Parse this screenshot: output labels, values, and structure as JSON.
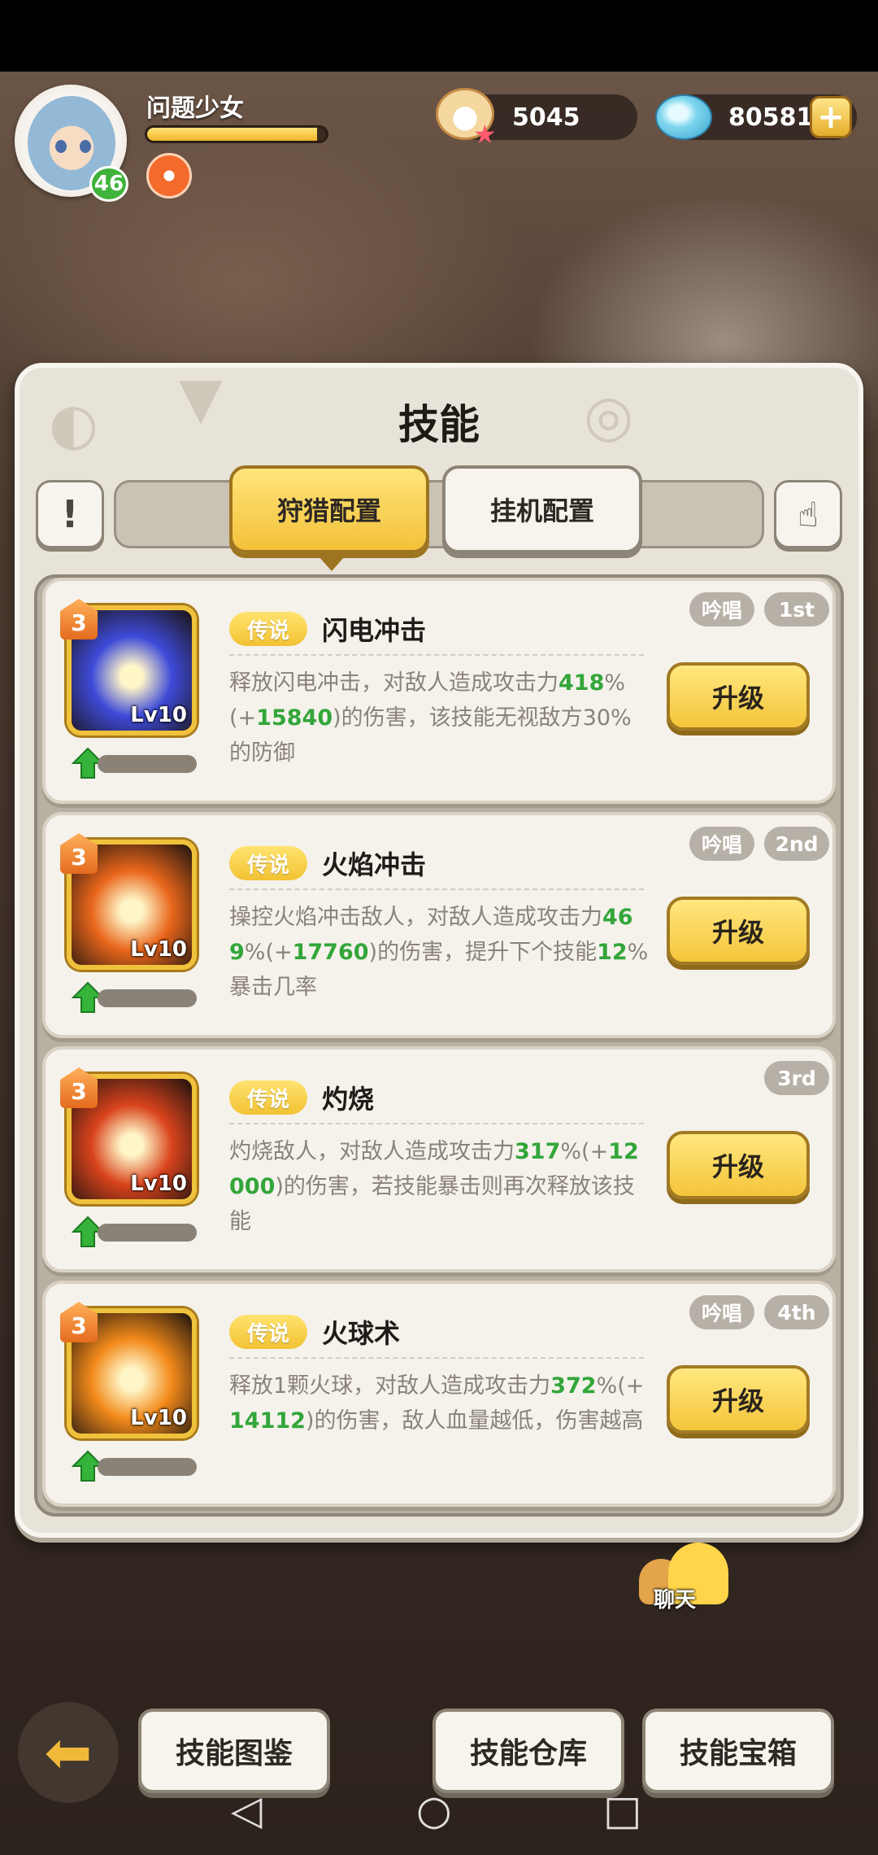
{
  "player": {
    "name": "问题少女",
    "level": "46",
    "xp_fraction": 0.95
  },
  "currency": {
    "pearls": "5045",
    "gems": "80581"
  },
  "panel": {
    "title": "技能"
  },
  "tabs": [
    {
      "label": "狩猎配置",
      "active": true
    },
    {
      "label": "挂机配置",
      "active": false
    }
  ],
  "skills": [
    {
      "star": "3",
      "level": "Lv10",
      "rarity": "传说",
      "name": "闪电冲击",
      "chant": "吟唱",
      "order": "1st",
      "desc_parts": [
        "释放闪电冲击，对敌人造成攻击力",
        "418",
        "%(+",
        "15840",
        ")的伤害，该技能无视敌方30%的防御"
      ],
      "upgrade": "升级",
      "icon_color": "#3d4ad8"
    },
    {
      "star": "3",
      "level": "Lv10",
      "rarity": "传说",
      "name": "火焰冲击",
      "chant": "吟唱",
      "order": "2nd",
      "desc_parts": [
        "操控火焰冲击敌人，对敌人造成攻击力",
        "469",
        "%(+",
        "17760",
        ")的伤害，提升下个技能",
        "12",
        "%暴击几率"
      ],
      "upgrade": "升级",
      "icon_color": "#e9661b"
    },
    {
      "star": "3",
      "level": "Lv10",
      "rarity": "传说",
      "name": "灼烧",
      "chant": "",
      "order": "3rd",
      "desc_parts": [
        "灼烧敌人，对敌人造成攻击力",
        "317",
        "%(+",
        "12000",
        ")的伤害，若技能暴击则再次释放该技能"
      ],
      "upgrade": "升级",
      "icon_color": "#d9431c"
    },
    {
      "star": "3",
      "level": "Lv10",
      "rarity": "传说",
      "name": "火球术",
      "chant": "吟唱",
      "order": "4th",
      "desc_parts": [
        "释放1颗火球，对敌人造成攻击力",
        "372",
        "%(+",
        "14112",
        ")的伤害，敌人血量越低，伤害越高"
      ],
      "upgrade": "升级",
      "icon_color": "#f28a1a"
    }
  ],
  "chat": {
    "label": "聊天"
  },
  "bottom": {
    "btn1": "技能图鉴",
    "btn2": "技能仓库",
    "btn3": "技能宝箱"
  },
  "colors": {
    "highlight": "#33a63a",
    "accent_yellow": "#f3c23a"
  }
}
